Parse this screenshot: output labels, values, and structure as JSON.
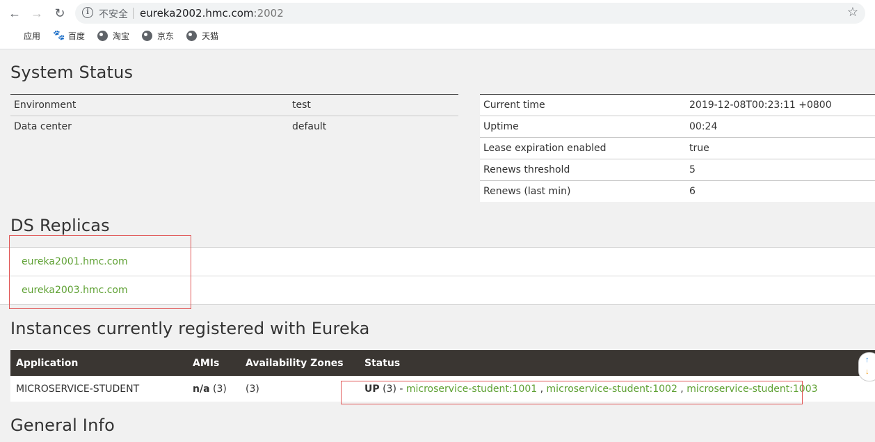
{
  "browser": {
    "back": "←",
    "forward": "→",
    "reload": "↻",
    "info": "i",
    "insecure_label": "不安全",
    "url_host": "eureka2002.hmc.com",
    "url_port": ":2002",
    "star": "☆",
    "bookmarks": [
      {
        "icon": "apps-icon",
        "label": "应用"
      },
      {
        "icon": "paw-icon",
        "label": "百度"
      },
      {
        "icon": "globe-icon",
        "label": "淘宝"
      },
      {
        "icon": "globe-icon",
        "label": "京东"
      },
      {
        "icon": "globe-icon",
        "label": "天猫"
      }
    ]
  },
  "system_status": {
    "title": "System Status",
    "left": [
      {
        "key": "Environment",
        "value": "test"
      },
      {
        "key": "Data center",
        "value": "default"
      }
    ],
    "right": [
      {
        "key": "Current time",
        "value": "2019-12-08T00:23:11 +0800"
      },
      {
        "key": "Uptime",
        "value": "00:24"
      },
      {
        "key": "Lease expiration enabled",
        "value": "true"
      },
      {
        "key": "Renews threshold",
        "value": "5"
      },
      {
        "key": "Renews (last min)",
        "value": "6"
      }
    ]
  },
  "ds_replicas": {
    "title": "DS Replicas",
    "items": [
      "eureka2001.hmc.com",
      "eureka2003.hmc.com"
    ]
  },
  "instances": {
    "title": "Instances currently registered with Eureka",
    "headers": [
      "Application",
      "AMIs",
      "Availability Zones",
      "Status"
    ],
    "rows": [
      {
        "application": "MICROSERVICE-STUDENT",
        "amis_bold": "n/a",
        "amis_count": " (3)",
        "zones": "(3)",
        "status_bold": "UP",
        "status_count": " (3) - ",
        "links": [
          "microservice-student:1001",
          "microservice-student:1002",
          "microservice-student:1003"
        ],
        "link_sep": " , "
      }
    ]
  },
  "general_info": {
    "title": "General Info"
  },
  "colors": {
    "header_bg": "#3a3632",
    "link": "#5fa134",
    "annotation": "#e05555"
  },
  "scroll": {
    "up": "↑",
    "down": "↓"
  }
}
